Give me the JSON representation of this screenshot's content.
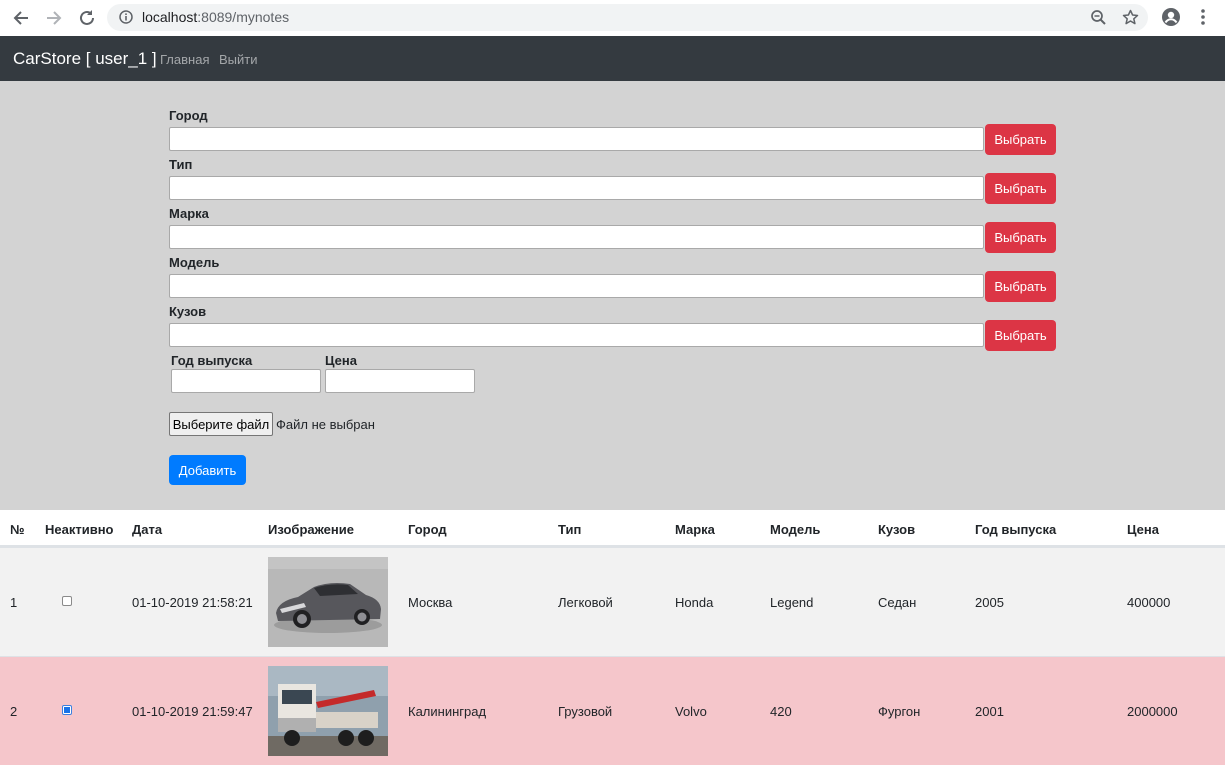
{
  "browser": {
    "url_host": "localhost",
    "url_path": ":8089/mynotes"
  },
  "navbar": {
    "brand": "CarStore [ user_1 ]",
    "links": [
      "Главная",
      "Выйти"
    ]
  },
  "form": {
    "fields": [
      {
        "label": "Город",
        "value": "",
        "button": "Выбрать"
      },
      {
        "label": "Тип",
        "value": "",
        "button": "Выбрать"
      },
      {
        "label": "Марка",
        "value": "",
        "button": "Выбрать"
      },
      {
        "label": "Модель",
        "value": "",
        "button": "Выбрать"
      },
      {
        "label": "Кузов",
        "value": "",
        "button": "Выбрать"
      }
    ],
    "year_label": "Год выпуска",
    "year_value": "",
    "price_label": "Цена",
    "price_value": "",
    "file_button": "Выберите файл",
    "file_status": "Файл не выбран",
    "add_button": "Добавить"
  },
  "table": {
    "headers": [
      "№",
      "Неактивно",
      "Дата",
      "Изображение",
      "Город",
      "Тип",
      "Марка",
      "Модель",
      "Кузов",
      "Год выпуска",
      "Цена"
    ],
    "rows": [
      {
        "num": "1",
        "inactive": false,
        "date": "01-10-2019 21:58:21",
        "image": "silver-sedan-photo",
        "city": "Москва",
        "type": "Легковой",
        "brand": "Honda",
        "model": "Legend",
        "body": "Седан",
        "year": "2005",
        "price": "400000"
      },
      {
        "num": "2",
        "inactive": true,
        "date": "01-10-2019 21:59:47",
        "image": "crane-truck-photo",
        "city": "Калининград",
        "type": "Грузовой",
        "brand": "Volvo",
        "model": "420",
        "body": "Фургон",
        "year": "2001",
        "price": "2000000"
      }
    ]
  },
  "colors": {
    "navbar": "#343a40",
    "form_bg": "#d3d3d3",
    "danger": "#dc3545",
    "primary": "#007bff",
    "inactive_row": "#f5c6cb"
  }
}
